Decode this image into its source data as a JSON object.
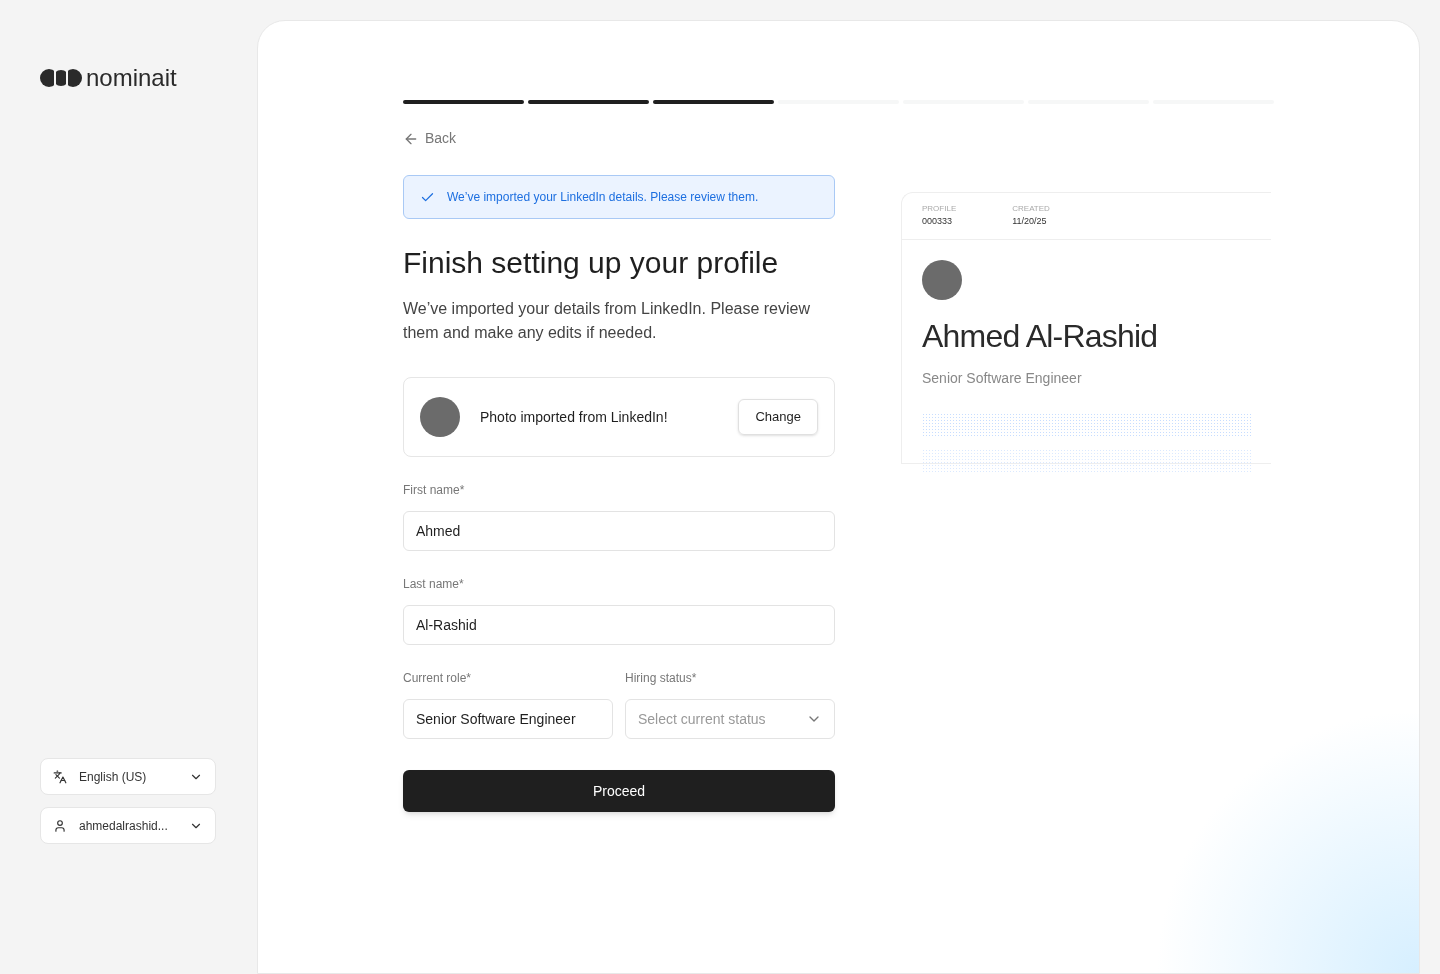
{
  "brand": {
    "name": "nominait"
  },
  "sidebar": {
    "language": {
      "label": "English (US)"
    },
    "account": {
      "label": "ahmedalrashid..."
    }
  },
  "progress": {
    "steps": [
      {
        "done": true
      },
      {
        "done": true
      },
      {
        "done": true
      },
      {
        "done": false
      },
      {
        "done": false
      },
      {
        "done": false
      },
      {
        "done": false
      }
    ]
  },
  "back": {
    "label": "Back"
  },
  "notice": {
    "text": "We’ve imported your LinkedIn details. Please review them."
  },
  "heading": "Finish setting up your profile",
  "intro": "We’ve imported your details from LinkedIn. Please review them and make any edits if needed.",
  "photo": {
    "label": "Photo imported from LinkedIn!",
    "button": "Change"
  },
  "fields": [
    {
      "label": "First name*",
      "value": "Ahmed"
    },
    {
      "label": "Last name*",
      "value": "Al-Rashid"
    }
  ],
  "role": {
    "label": "Current role*",
    "value": "Senior Software Engineer"
  },
  "hiring_status": {
    "label": "Hiring status*",
    "placeholder": "Select current status"
  },
  "proceed": "Proceed",
  "preview": {
    "meta": [
      {
        "label": "PROFILE",
        "value": "000333"
      },
      {
        "label": "CREATED",
        "value": "11/20/25"
      }
    ],
    "name": "Ahmed Al-Rashid",
    "role": "Senior Software Engineer"
  }
}
